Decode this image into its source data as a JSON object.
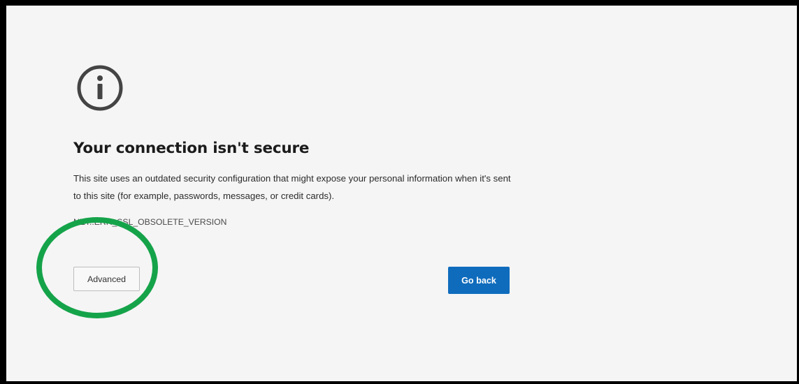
{
  "page": {
    "icon": "info-circle-icon",
    "title": "Your connection isn't secure",
    "description": "This site uses an outdated security configuration that might expose your personal information when it's sent to this site (for example, passwords, messages, or credit cards).",
    "error_code": "NET::ERR_SSL_OBSOLETE_VERSION"
  },
  "buttons": {
    "advanced_label": "Advanced",
    "go_back_label": "Go back"
  },
  "annotation": {
    "shape": "circle",
    "target": "advanced-button",
    "color": "#15a34a"
  },
  "colors": {
    "page_background": "#f5f5f5",
    "frame": "#000000",
    "primary_button": "#0f6cbd",
    "icon": "#444444"
  }
}
